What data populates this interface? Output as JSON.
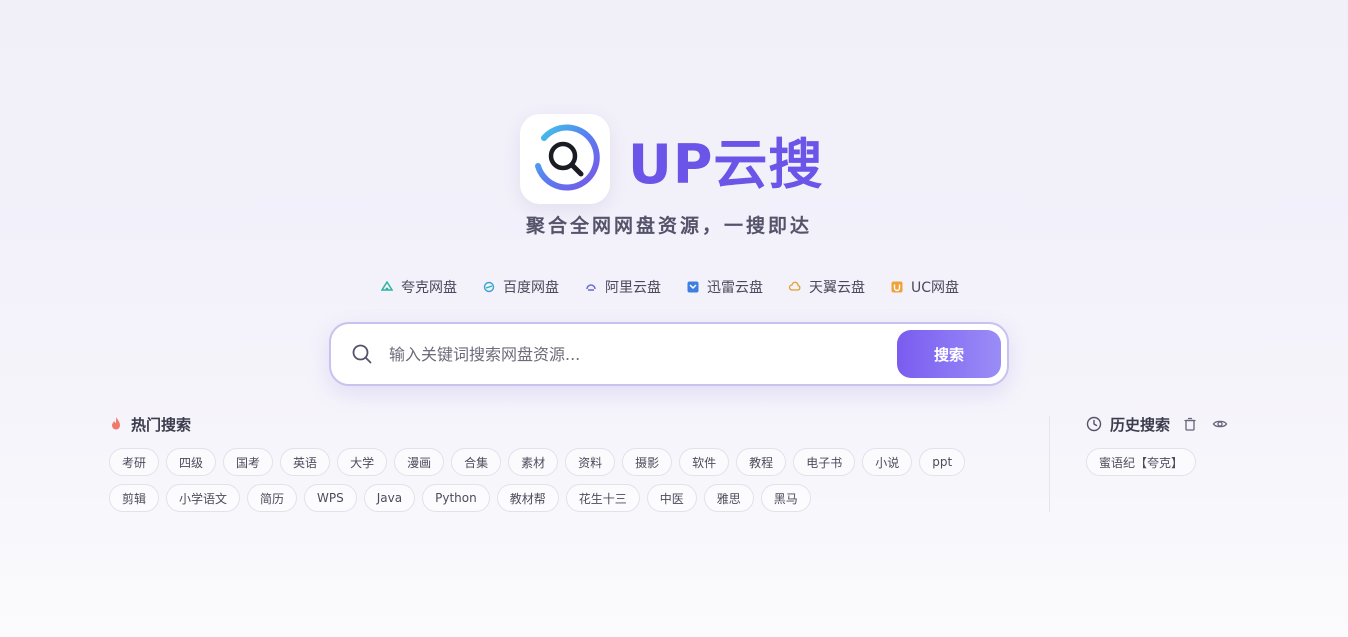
{
  "brand": {
    "title": "UP云搜",
    "tagline": "聚合全网网盘资源，一搜即达",
    "accent_color": "#6a55e8"
  },
  "providers": [
    {
      "label": "夸克网盘",
      "icon": "quark-icon",
      "color": "#2bb5a0"
    },
    {
      "label": "百度网盘",
      "icon": "baidu-netdisk-icon",
      "color": "#3aa0d8"
    },
    {
      "label": "阿里云盘",
      "icon": "aliyun-drive-icon",
      "color": "#6d6fd8"
    },
    {
      "label": "迅雷云盘",
      "icon": "xunlei-icon",
      "color": "#3d7fe0"
    },
    {
      "label": "天翼云盘",
      "icon": "tianyi-cloud-icon",
      "color": "#e0a42b"
    },
    {
      "label": "UC网盘",
      "icon": "uc-netdisk-icon",
      "color": "#f0a23a"
    }
  ],
  "search": {
    "placeholder": "输入关键词搜索网盘资源...",
    "value": "",
    "button_label": "搜索"
  },
  "hot": {
    "title": "热门搜索",
    "tags": [
      "考研",
      "四级",
      "国考",
      "英语",
      "大学",
      "漫画",
      "合集",
      "素材",
      "资料",
      "摄影",
      "软件",
      "教程",
      "电子书",
      "小说",
      "ppt",
      "剪辑",
      "小学语文",
      "简历",
      "WPS",
      "Java",
      "Python",
      "教材帮",
      "花生十三",
      "中医",
      "雅思",
      "黑马"
    ]
  },
  "history": {
    "title": "历史搜索",
    "tags": [
      "蜜语纪【夸克】"
    ]
  }
}
